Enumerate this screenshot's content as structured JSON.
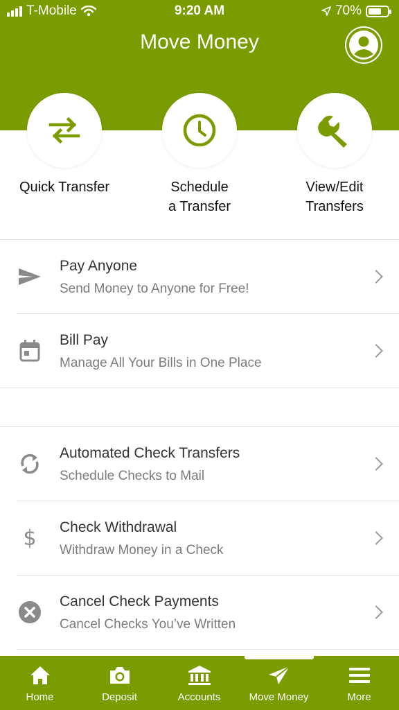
{
  "status_bar": {
    "carrier": "T-Mobile",
    "time": "9:20 AM",
    "battery": "70%",
    "battery_level": 0.7
  },
  "header": {
    "title": "Move Money",
    "profile_icon": "person-circle-icon",
    "background_color": "#7a9c00"
  },
  "quick_actions": [
    {
      "label": "Quick Transfer",
      "icon": "swap-arrows-icon"
    },
    {
      "label": "Schedule\na Transfer",
      "icon": "clock-icon"
    },
    {
      "label": "View/Edit\nTransfers",
      "icon": "wrench-icon"
    }
  ],
  "menu_group_1": [
    {
      "title": "Pay Anyone",
      "subtitle": "Send Money to Anyone for Free!",
      "icon": "send-icon"
    },
    {
      "title": "Bill Pay",
      "subtitle": "Manage All Your Bills in One Place",
      "icon": "calendar-icon"
    }
  ],
  "menu_group_2": [
    {
      "title": "Automated Check Transfers",
      "subtitle": "Schedule Checks to Mail",
      "icon": "sync-icon"
    },
    {
      "title": "Check Withdrawal",
      "subtitle": "Withdraw Money in a Check",
      "icon": "dollar-icon"
    },
    {
      "title": "Cancel Check Payments",
      "subtitle": "Cancel Checks You’ve Written",
      "icon": "cancel-circle-icon"
    }
  ],
  "tabbar": {
    "items": [
      {
        "label": "Home",
        "icon": "home-icon"
      },
      {
        "label": "Deposit",
        "icon": "camera-icon"
      },
      {
        "label": "Accounts",
        "icon": "bank-icon"
      },
      {
        "label": "Move Money",
        "icon": "paper-plane-icon"
      },
      {
        "label": "More",
        "icon": "menu-icon"
      }
    ],
    "active": "Move Money"
  }
}
